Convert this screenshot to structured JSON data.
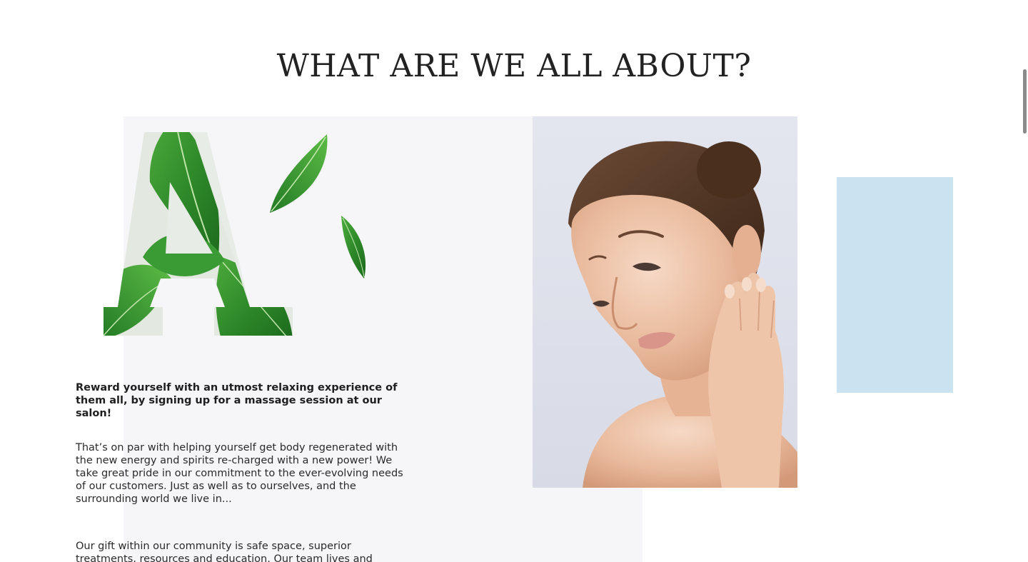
{
  "section": {
    "title": "WHAT ARE WE ALL ABOUT?"
  },
  "graphic": {
    "letter": "A",
    "icon": "leaf-letter-a-graphic"
  },
  "photo": {
    "icon": "woman-portrait-photo"
  },
  "content": {
    "lead": "Reward yourself with an utmost relaxing experience of them all, by signing up for a massage session at our salon!",
    "paragraph_1": "That’s on par with helping yourself get body regenerated with the new energy and spirits re-charged with a new power! We take great pride in our commitment to the ever-evolving needs of our customers. Just as well as to ourselves, and the surrounding world we live in...",
    "paragraph_2": "Our gift within our community is safe space, superior treatments, resources and education. Our team lives and"
  },
  "colors": {
    "panel_bg": "#f6f6f8",
    "accent_blue": "#c9e4f0",
    "leaf_green": "#2e8b2e",
    "text": "#222222"
  }
}
